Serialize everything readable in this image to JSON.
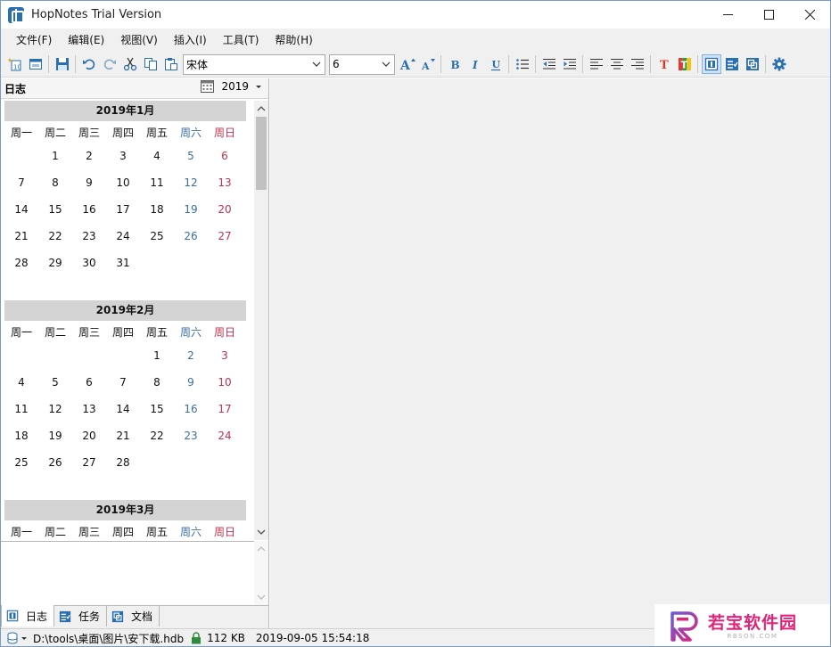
{
  "window": {
    "title": "HopNotes Trial Version"
  },
  "menu": [
    {
      "label": "文件(F)"
    },
    {
      "label": "编辑(E)"
    },
    {
      "label": "视图(V)"
    },
    {
      "label": "插入(I)"
    },
    {
      "label": "工具(T)"
    },
    {
      "label": "帮助(H)"
    }
  ],
  "toolbar": {
    "font_value": "宋体",
    "size_value": "6"
  },
  "left_panel": {
    "title": "日志",
    "year": "2019"
  },
  "weekdays": [
    "周一",
    "周二",
    "周三",
    "周四",
    "周五",
    "周六",
    "周日"
  ],
  "months": [
    {
      "title": "2019年1月",
      "weeks": [
        [
          "",
          "1",
          "2",
          "3",
          "4",
          "5",
          "6"
        ],
        [
          "7",
          "8",
          "9",
          "10",
          "11",
          "12",
          "13"
        ],
        [
          "14",
          "15",
          "16",
          "17",
          "18",
          "19",
          "20"
        ],
        [
          "21",
          "22",
          "23",
          "24",
          "25",
          "26",
          "27"
        ],
        [
          "28",
          "29",
          "30",
          "31",
          "",
          "",
          ""
        ]
      ]
    },
    {
      "title": "2019年2月",
      "weeks": [
        [
          "",
          "",
          "",
          "",
          "1",
          "2",
          "3"
        ],
        [
          "4",
          "5",
          "6",
          "7",
          "8",
          "9",
          "10"
        ],
        [
          "11",
          "12",
          "13",
          "14",
          "15",
          "16",
          "17"
        ],
        [
          "18",
          "19",
          "20",
          "21",
          "22",
          "23",
          "24"
        ],
        [
          "25",
          "26",
          "27",
          "28",
          "",
          "",
          ""
        ]
      ]
    },
    {
      "title": "2019年3月",
      "weeks": []
    }
  ],
  "tabs": [
    {
      "label": "日志"
    },
    {
      "label": "任务"
    },
    {
      "label": "文档"
    }
  ],
  "status": {
    "path": "D:\\tools\\桌面\\图片\\安下载.hdb",
    "size": "112 KB",
    "datetime": "2019-09-05 15:54:18"
  },
  "watermark": {
    "cn": "若宝软件园",
    "en": "RBSON.COM"
  },
  "colors": {
    "saturday": "#3b6ea5",
    "sunday": "#c0334d",
    "accent": "#2a6fb0",
    "watermark": "#e0247a"
  }
}
